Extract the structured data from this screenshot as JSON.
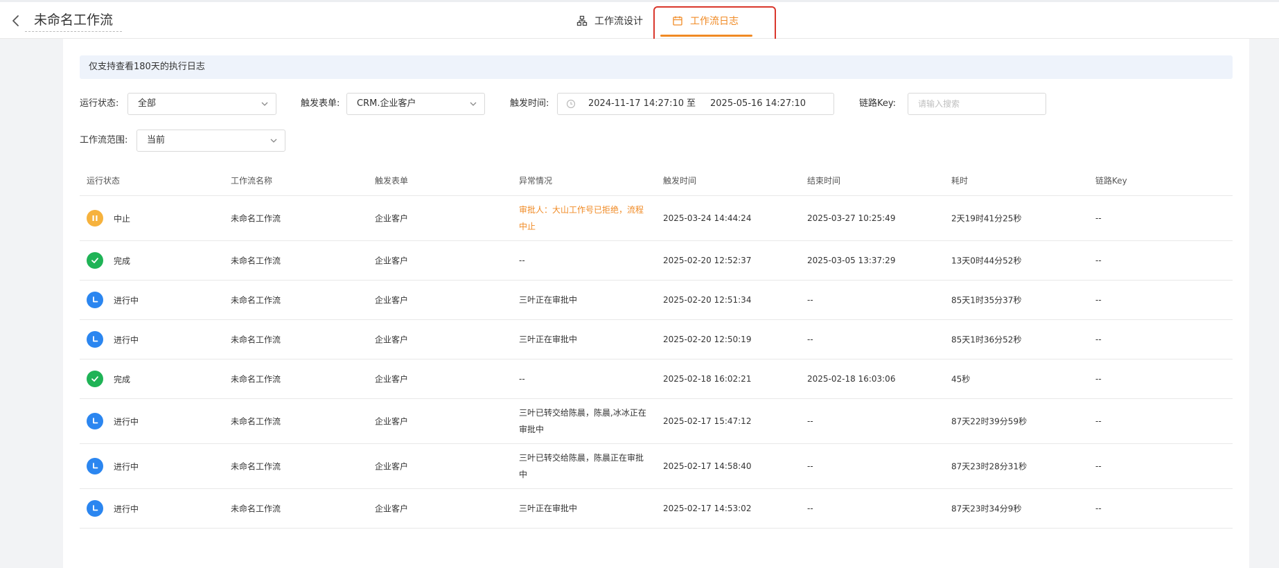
{
  "header": {
    "title": "未命名工作流",
    "tabs": [
      {
        "label": "工作流设计",
        "icon": "workflow-icon"
      },
      {
        "label": "工作流日志",
        "icon": "calendar-icon",
        "active": true
      }
    ]
  },
  "notice": "仅支持查看180天的执行日志",
  "filters": {
    "status": {
      "label": "运行状态:",
      "value": "全部"
    },
    "form": {
      "label": "触发表单:",
      "value": "CRM.企业客户"
    },
    "time": {
      "label": "触发时间:",
      "start": "2024-11-17 14:27:10",
      "sep": "至",
      "end": "2025-05-16 14:27:10"
    },
    "key": {
      "label": "链路Key:",
      "placeholder": "请输入搜索"
    },
    "scope": {
      "label": "工作流范围:",
      "value": "当前"
    }
  },
  "table": {
    "headers": [
      "运行状态",
      "工作流名称",
      "触发表单",
      "异常情况",
      "触发时间",
      "结束时间",
      "耗时",
      "链路Key"
    ],
    "rows": [
      {
        "status": "中止",
        "type": "pause",
        "name": "未命名工作流",
        "form": "企业客户",
        "exception": "审批人：大山工作号已拒绝，流程中止",
        "highlight": true,
        "start": "2025-03-24 14:44:24",
        "end": "2025-03-27 10:25:49",
        "duration": "2天19时41分25秒",
        "key": "--"
      },
      {
        "status": "完成",
        "type": "done",
        "name": "未命名工作流",
        "form": "企业客户",
        "exception": "--",
        "start": "2025-02-20 12:52:37",
        "end": "2025-03-05 13:37:29",
        "duration": "13天0时44分52秒",
        "key": "--"
      },
      {
        "status": "进行中",
        "type": "running",
        "name": "未命名工作流",
        "form": "企业客户",
        "exception": "三叶正在审批中",
        "start": "2025-02-20 12:51:34",
        "end": "--",
        "duration": "85天1时35分37秒",
        "key": "--"
      },
      {
        "status": "进行中",
        "type": "running",
        "name": "未命名工作流",
        "form": "企业客户",
        "exception": "三叶正在审批中",
        "start": "2025-02-20 12:50:19",
        "end": "--",
        "duration": "85天1时36分52秒",
        "key": "--"
      },
      {
        "status": "完成",
        "type": "done",
        "name": "未命名工作流",
        "form": "企业客户",
        "exception": "--",
        "start": "2025-02-18 16:02:21",
        "end": "2025-02-18 16:03:06",
        "duration": "45秒",
        "key": "--"
      },
      {
        "status": "进行中",
        "type": "running",
        "name": "未命名工作流",
        "form": "企业客户",
        "exception": "三叶已转交给陈晨，陈晨,冰冰正在审批中",
        "start": "2025-02-17 15:47:12",
        "end": "--",
        "duration": "87天22时39分59秒",
        "key": "--"
      },
      {
        "status": "进行中",
        "type": "running",
        "name": "未命名工作流",
        "form": "企业客户",
        "exception": "三叶已转交给陈晨，陈晨正在审批中",
        "start": "2025-02-17 14:58:40",
        "end": "--",
        "duration": "87天23时28分31秒",
        "key": "--"
      },
      {
        "status": "进行中",
        "type": "running",
        "name": "未命名工作流",
        "form": "企业客户",
        "exception": "三叶正在审批中",
        "start": "2025-02-17 14:53:02",
        "end": "--",
        "duration": "87天23时34分9秒",
        "key": "--"
      }
    ]
  },
  "colors": {
    "accent": "#f08a24",
    "running": "#2b86f0",
    "done": "#1fb356",
    "pause": "#f6b23d"
  }
}
